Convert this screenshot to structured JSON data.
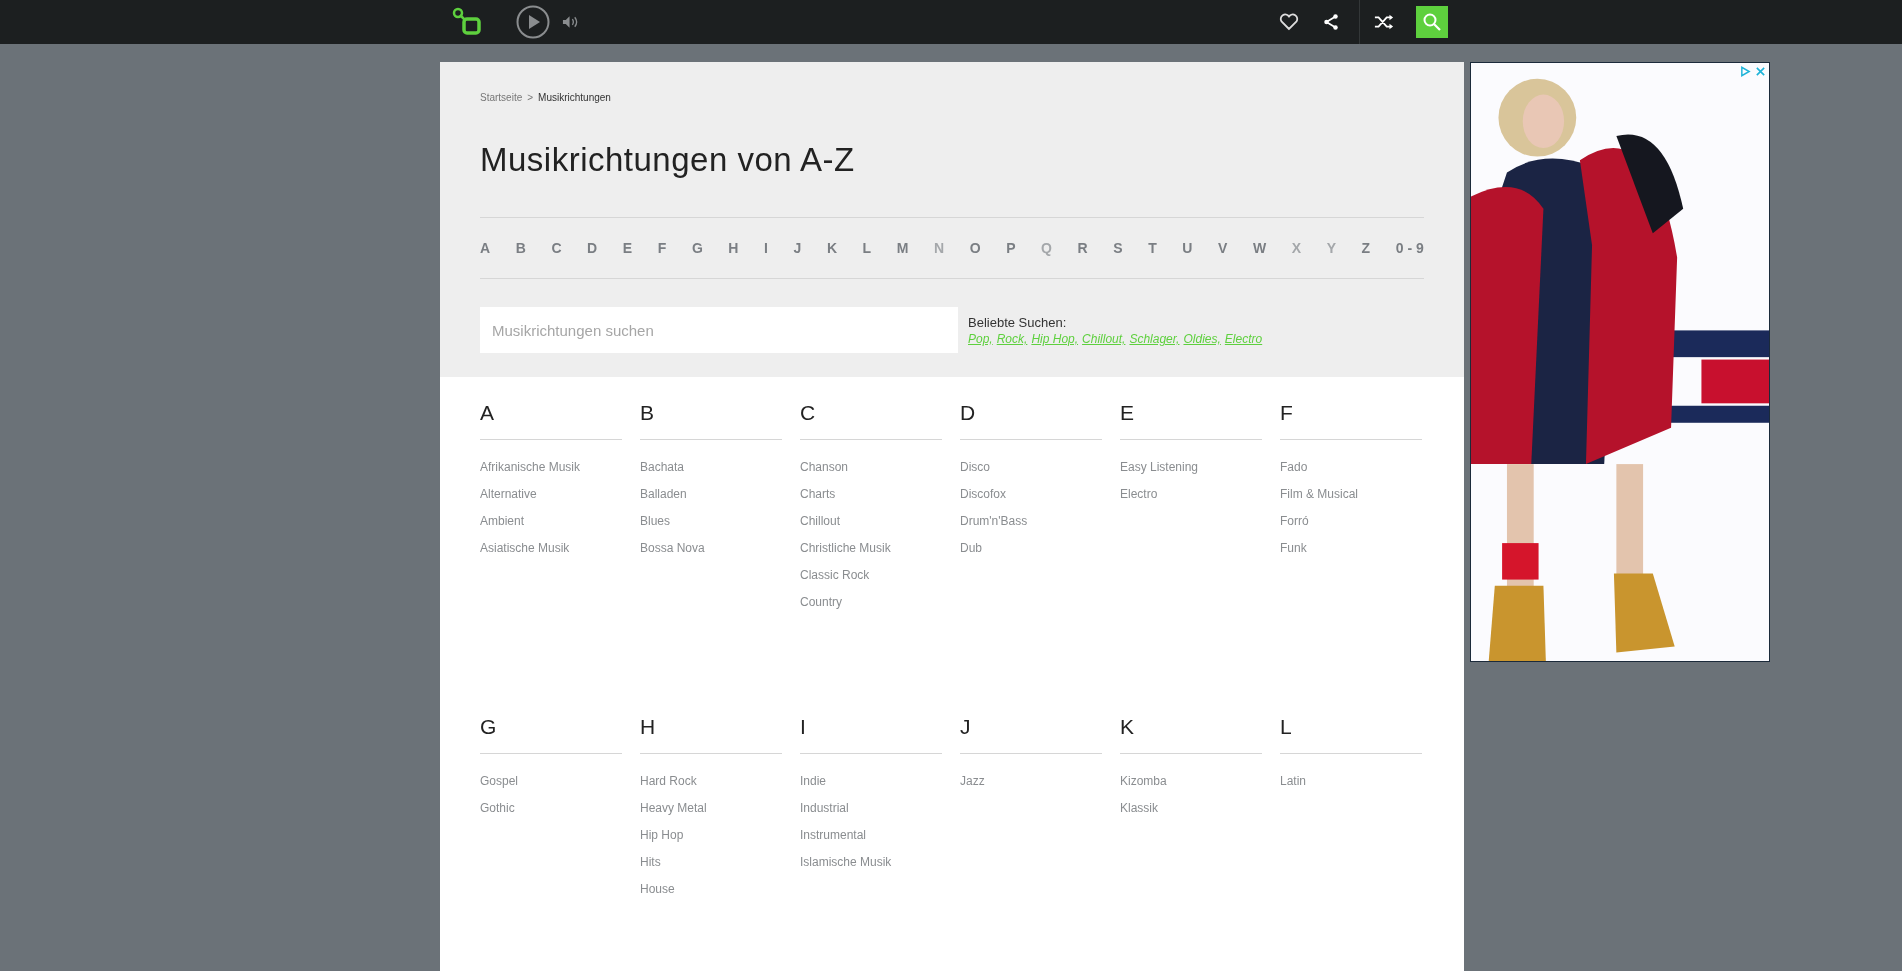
{
  "breadcrumb": [
    {
      "label": "Startseite",
      "separator": ">"
    },
    {
      "label": "Musikrichtungen"
    }
  ],
  "title": "Musikrichtungen von A-Z",
  "alphabet": [
    {
      "label": "A",
      "disabled": false
    },
    {
      "label": "B",
      "disabled": false
    },
    {
      "label": "C",
      "disabled": false
    },
    {
      "label": "D",
      "disabled": false
    },
    {
      "label": "E",
      "disabled": false
    },
    {
      "label": "F",
      "disabled": false
    },
    {
      "label": "G",
      "disabled": false
    },
    {
      "label": "H",
      "disabled": false
    },
    {
      "label": "I",
      "disabled": false
    },
    {
      "label": "J",
      "disabled": false
    },
    {
      "label": "K",
      "disabled": false
    },
    {
      "label": "L",
      "disabled": false
    },
    {
      "label": "M",
      "disabled": false
    },
    {
      "label": "N",
      "disabled": true
    },
    {
      "label": "O",
      "disabled": false
    },
    {
      "label": "P",
      "disabled": false
    },
    {
      "label": "Q",
      "disabled": true
    },
    {
      "label": "R",
      "disabled": false
    },
    {
      "label": "S",
      "disabled": false
    },
    {
      "label": "T",
      "disabled": false
    },
    {
      "label": "U",
      "disabled": false
    },
    {
      "label": "V",
      "disabled": false
    },
    {
      "label": "W",
      "disabled": false
    },
    {
      "label": "X",
      "disabled": true
    },
    {
      "label": "Y",
      "disabled": true
    },
    {
      "label": "Z",
      "disabled": false
    },
    {
      "label": "0 - 9",
      "disabled": false
    }
  ],
  "search": {
    "placeholder": "Musikrichtungen suchen"
  },
  "popular": {
    "label": "Beliebte Suchen:",
    "links": [
      "Pop,",
      "Rock,",
      "Hip Hop,",
      "Chillout,",
      "Schlager,",
      "Oldies,",
      "Electro"
    ]
  },
  "groups": [
    {
      "letter": "A",
      "genres": [
        "Afrikanische Musik",
        "Alternative",
        "Ambient",
        "Asiatische Musik"
      ]
    },
    {
      "letter": "B",
      "genres": [
        "Bachata",
        "Balladen",
        "Blues",
        "Bossa Nova"
      ]
    },
    {
      "letter": "C",
      "genres": [
        "Chanson",
        "Charts",
        "Chillout",
        "Christliche Musik",
        "Classic Rock",
        "Country"
      ]
    },
    {
      "letter": "D",
      "genres": [
        "Disco",
        "Discofox",
        "Drum'n'Bass",
        "Dub"
      ]
    },
    {
      "letter": "E",
      "genres": [
        "Easy Listening",
        "Electro"
      ]
    },
    {
      "letter": "F",
      "genres": [
        "Fado",
        "Film & Musical",
        "Forró",
        "Funk"
      ]
    },
    {
      "letter": "G",
      "genres": [
        "Gospel",
        "Gothic"
      ]
    },
    {
      "letter": "H",
      "genres": [
        "Hard Rock",
        "Heavy Metal",
        "Hip Hop",
        "Hits",
        "House"
      ]
    },
    {
      "letter": "I",
      "genres": [
        "Indie",
        "Industrial",
        "Instrumental",
        "Islamische Musik"
      ]
    },
    {
      "letter": "J",
      "genres": [
        "Jazz"
      ]
    },
    {
      "letter": "K",
      "genres": [
        "Kizomba",
        "Klassik"
      ]
    },
    {
      "letter": "L",
      "genres": [
        "Latin"
      ]
    }
  ]
}
